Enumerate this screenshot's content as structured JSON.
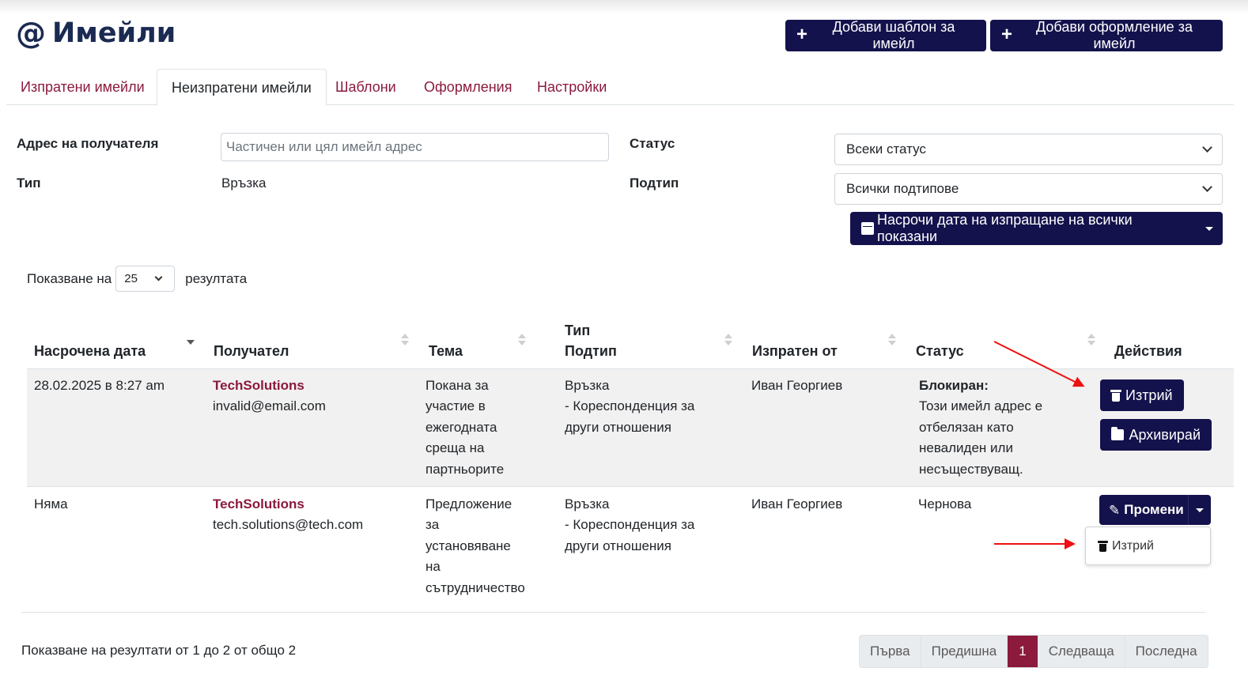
{
  "header": {
    "title": "Имейли",
    "add_template_label": "Добави шаблон за имейл",
    "add_layout_label": "Добави оформление за имейл"
  },
  "tabs": [
    {
      "label": "Изпратени имейли"
    },
    {
      "label": "Неизпратени имейли",
      "active": true
    },
    {
      "label": "Шаблони"
    },
    {
      "label": "Оформления"
    },
    {
      "label": "Настройки"
    }
  ],
  "filters": {
    "recipient_label": "Адрес на получателя",
    "recipient_placeholder": "Частичен или цял имейл адрес",
    "status_label": "Статус",
    "status_value": "Всеки статус",
    "type_label": "Тип",
    "type_value": "Връзка",
    "subtype_label": "Подтип",
    "subtype_value": "Всички подтипове",
    "schedule_all_label": "Насрочи дата на изпращане на всички показани"
  },
  "page_size": {
    "prefix": "Показване на",
    "value": "25",
    "suffix": "резултата"
  },
  "table": {
    "headers": {
      "scheduled_date": "Насрочена дата",
      "recipient": "Получател",
      "subject": "Тема",
      "type": "Тип",
      "subtype": "Подтип",
      "sent_by": "Изпратен от",
      "status": "Статус",
      "actions": "Действия"
    },
    "rows": [
      {
        "date": "28.02.2025 в 8:27 am",
        "company": "TechSolutions",
        "email": "invalid@email.com",
        "subject": [
          "Покана за",
          "участие в",
          "ежегодната",
          "среща на",
          "партньорите"
        ],
        "type": "Връзка",
        "subtype": [
          "- Кореспонденция за",
          "други отношения"
        ],
        "sent_by": "Иван Георгиев",
        "status_title": "Блокиран:",
        "status_text": [
          "Този имейл адрес е",
          "отбелязан като",
          "невалиден или",
          "несъществуващ."
        ],
        "actions": {
          "delete": "Изтрий",
          "archive": "Архивирай"
        }
      },
      {
        "date": "Няма",
        "company": "TechSolutions",
        "email": "tech.solutions@tech.com",
        "subject": [
          "Предложение",
          "за",
          "установяване",
          "на",
          "сътрудничество"
        ],
        "type": "Връзка",
        "subtype": [
          "- Кореспонденция за",
          "други отношения"
        ],
        "sent_by": "Иван Георгиев",
        "status_title": "Чернова",
        "actions": {
          "edit": "Промени",
          "dropdown_delete": "Изтрий"
        }
      }
    ]
  },
  "footer": {
    "summary": "Показване на резултати от 1 до 2 от общо 2",
    "pagination": {
      "first": "Първа",
      "prev": "Предишна",
      "current": "1",
      "next": "Следваща",
      "last": "Последна"
    }
  },
  "colors": {
    "navy": "#14124c",
    "accent": "#8b1a3c",
    "annotation": "#ee1111"
  }
}
